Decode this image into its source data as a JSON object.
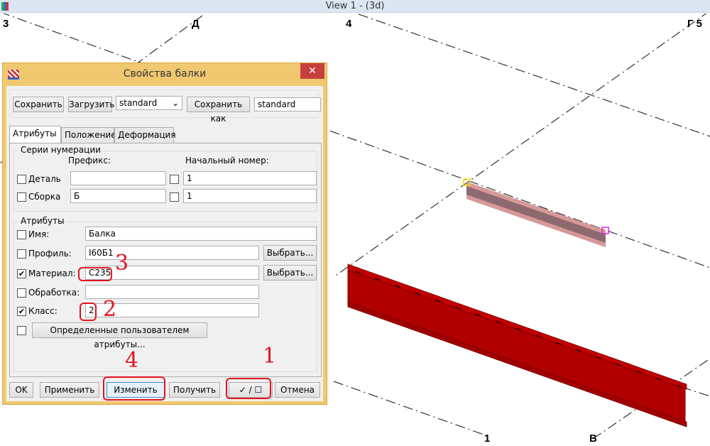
{
  "window": {
    "title": "View 1 - (3d)"
  },
  "grid_labels": {
    "g3": "3",
    "gD": "Д",
    "g4": "4",
    "gG5": "Г 5",
    "g1": "1",
    "gV": "В"
  },
  "colors": {
    "beam": "#b00000",
    "beam_selected": "#d89898",
    "accent_red": "#e0141e",
    "dialog_frame": "#f0c870"
  },
  "dialog": {
    "title": "Свойства балки",
    "close": "✕",
    "toolbar": {
      "save": "Сохранить",
      "load": "Загрузить",
      "preset_select": "standard",
      "save_as": "Сохранить как",
      "save_as_name": "standard"
    },
    "tabs": [
      {
        "label": "Атрибуты"
      },
      {
        "label": "Положение"
      },
      {
        "label": "Деформация"
      }
    ],
    "numbering": {
      "title": "Серии нумерации",
      "prefix_header": "Префикс:",
      "start_header": "Начальный номер:",
      "rows": [
        {
          "label": "Деталь",
          "prefix": "",
          "start": "1"
        },
        {
          "label": "Сборка",
          "prefix": "Б",
          "start": "1"
        }
      ]
    },
    "attributes": {
      "title": "Атрибуты",
      "name_label": "Имя:",
      "name_value": "Балка",
      "profile_label": "Профиль:",
      "profile_value": "I60Б1",
      "select1": "Выбрать...",
      "material_label": "Материал:",
      "material_value": "С235",
      "select2": "Выбрать...",
      "finish_label": "Обработка:",
      "finish_value": "",
      "class_label": "Класс:",
      "class_value": "2",
      "udf": "Определенные пользователем атрибуты..."
    },
    "footer": {
      "ok": "OK",
      "apply": "Применить",
      "modify": "Изменить",
      "get": "Получить",
      "toggle": "✓ / ☐",
      "cancel": "Отмена"
    },
    "annotations": {
      "n1": "1",
      "n2": "2",
      "n3": "3",
      "n4": "4"
    }
  }
}
